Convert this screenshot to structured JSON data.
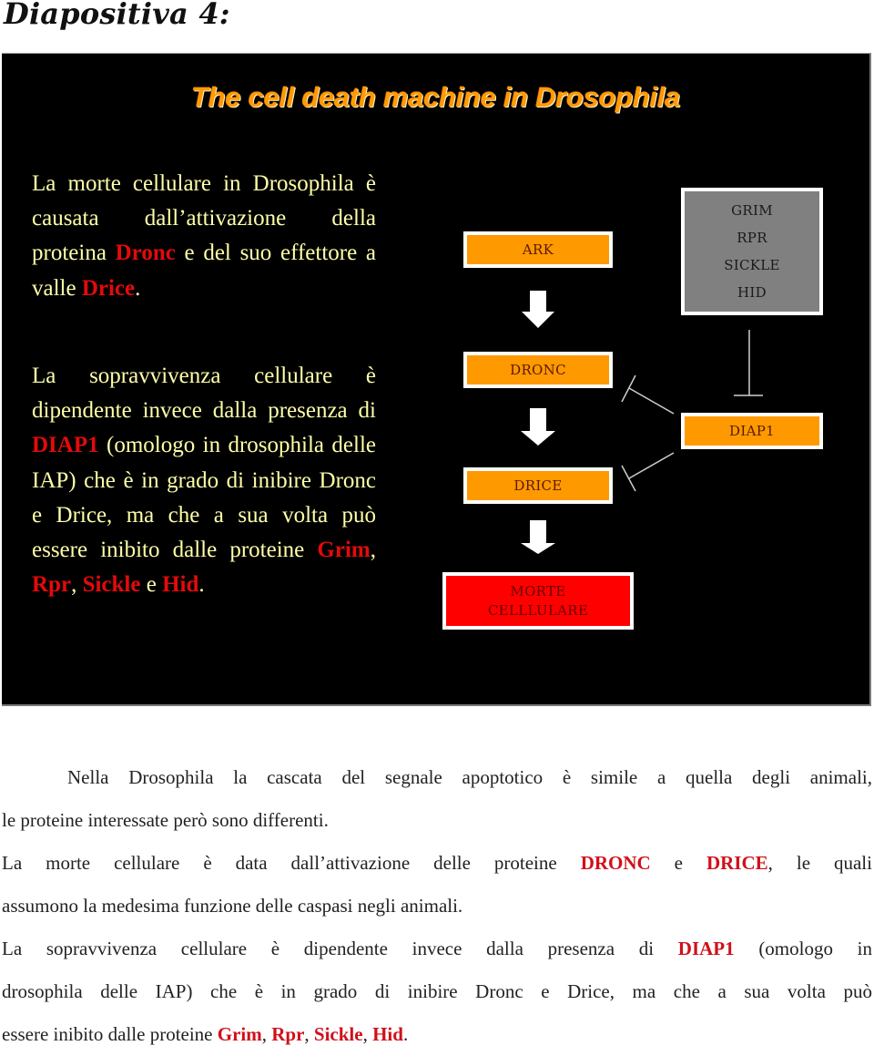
{
  "page": {
    "heading": "Diapositiva 4:"
  },
  "slide": {
    "title": "The cell death machine in Drosophila",
    "paragraph1": {
      "t1": "La morte cellulare in Drosophila è causata dall’attivazione della proteina ",
      "h1": "Dronc",
      "t2": " e del suo effettore a valle ",
      "h2": "Drice",
      "t3": "."
    },
    "paragraph2": {
      "t1": "La sopravvivenza cellulare è dipendente invece dalla presenza di ",
      "h1": "DIAP1",
      "t2": " (omologo in drosophila delle IAP) che è in grado di inibire Dronc e Drice, ma che a sua volta può essere inibito dalle proteine ",
      "h2": "Grim",
      "s1": ", ",
      "h3": "Rpr",
      "s2": ", ",
      "h4": "Sickle",
      "s3": " e ",
      "h5": "Hid",
      "t3": "."
    },
    "diagram": {
      "ark": "ARK",
      "dronc": "DRONC",
      "drice": "DRICE",
      "morte_line1": "MORTE",
      "morte_line2": "CELLLULARE",
      "inhibitors": [
        "GRIM",
        "RPR",
        "SICKLE",
        "HID"
      ],
      "diap1": "DIAP1",
      "colors": {
        "orange_box": "#ff9900",
        "red_box": "#ff0000",
        "gray_box": "#808080",
        "title": "#ff9a05",
        "body_text": "#ffffa8",
        "highlight": "#e50a0a"
      }
    }
  },
  "document": {
    "lines": [
      {
        "parts": [
          {
            "t": "Nella Drosophila la cascata del segnale apoptotico è simile a quella degli animali,"
          }
        ]
      },
      {
        "parts": [
          {
            "t": "le proteine interessate però sono differenti."
          }
        ]
      },
      {
        "parts": [
          {
            "t": "La morte cellulare è data dall’attivazione delle proteine "
          },
          {
            "h": "DRONC"
          },
          {
            "t": " e "
          },
          {
            "h": "DRICE"
          },
          {
            "t": ", le quali"
          }
        ]
      },
      {
        "parts": [
          {
            "t": "assumono la medesima funzione delle caspasi negli animali."
          }
        ]
      },
      {
        "parts": [
          {
            "t": "La sopravvivenza cellulare è dipendente invece dalla presenza di "
          },
          {
            "h": "DIAP1"
          },
          {
            "t": " (omologo in"
          }
        ]
      },
      {
        "parts": [
          {
            "t": "drosophila delle IAP) che è in grado di inibire Dronc e Drice, ma che a sua volta può"
          }
        ]
      },
      {
        "parts": [
          {
            "t": "essere inibito dalle proteine "
          },
          {
            "h": "Grim"
          },
          {
            "t": ", "
          },
          {
            "h": "Rpr"
          },
          {
            "t": ", "
          },
          {
            "h": "Sickle"
          },
          {
            "t": ", "
          },
          {
            "h": "Hid"
          },
          {
            "t": "."
          }
        ]
      }
    ],
    "highlight_color": "#d0101a"
  }
}
